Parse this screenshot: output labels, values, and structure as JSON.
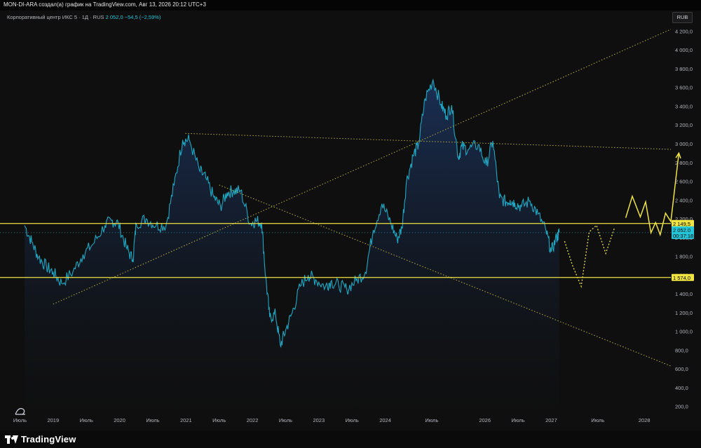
{
  "header": {
    "title": "MON-DI-ARA создал(а) график на TradingView.com, Авг 13, 2026 20:12 UTC+3"
  },
  "legend": {
    "symbol": "Корпоративный центр ИКС 5 · 1Д · RUS",
    "price": "2 052,0",
    "change": "−54,5 (−2,59%)"
  },
  "currency_button": "RUB",
  "branding": {
    "name": "TradingView",
    "icon": "tradingview-logo-icon"
  },
  "colors": {
    "price_line": "#1fa8c4",
    "level_line": "#f0e442",
    "trend_line": "#b8b040",
    "forecast": "#f0e442",
    "background": "#0f0f0f"
  },
  "chart_data": {
    "type": "area",
    "title": "",
    "series": [
      {
        "name": "Корпоративный центр ИКС 5",
        "color": "#1fa8c4"
      }
    ],
    "x": [
      2018.57,
      2018.68,
      2018.78,
      2018.9,
      2019.0,
      2019.13,
      2019.3,
      2019.45,
      2019.6,
      2019.78,
      2019.88,
      2019.98,
      2020.1,
      2020.2,
      2020.25,
      2020.4,
      2020.55,
      2020.7,
      2020.82,
      2020.95,
      2021.05,
      2021.2,
      2021.3,
      2021.42,
      2021.52,
      2021.62,
      2021.72,
      2021.82,
      2021.97,
      2022.05,
      2022.14,
      2022.2,
      2022.26,
      2022.35,
      2022.42,
      2022.5,
      2022.6,
      2022.72,
      2022.84,
      2022.95,
      2023.1,
      2023.18,
      2023.3,
      2023.42,
      2023.56,
      2023.7,
      2023.82,
      2023.95,
      2024.08,
      2024.18,
      2024.25,
      2024.32,
      2024.42,
      2024.5,
      2024.6,
      2024.72,
      2024.84,
      2024.92,
      2025.0,
      2025.1,
      2025.15,
      2025.25,
      2025.4,
      2025.52,
      2025.62,
      2025.72,
      2025.82,
      2025.88,
      2025.95,
      2026.05,
      2026.18,
      2026.3,
      2026.42,
      2026.5,
      2026.58,
      2026.62
    ],
    "y": [
      2130,
      1950,
      1790,
      1690,
      1630,
      1510,
      1640,
      1820,
      1930,
      2130,
      2180,
      2150,
      1900,
      1760,
      2150,
      2200,
      2130,
      2130,
      2560,
      3040,
      3040,
      2720,
      2630,
      2430,
      2330,
      2480,
      2500,
      2500,
      2150,
      2180,
      2160,
      1580,
      1150,
      1180,
      850,
      1010,
      1200,
      1480,
      1600,
      1550,
      1480,
      1530,
      1490,
      1450,
      1540,
      1630,
      2080,
      2360,
      2160,
      1980,
      2100,
      2600,
      2870,
      2990,
      3480,
      3680,
      3420,
      3300,
      3410,
      2850,
      2970,
      2940,
      2990,
      2770,
      3030,
      2420,
      2380,
      2400,
      2370,
      2330,
      2390,
      2250,
      2070,
      1850,
      2000,
      2052
    ],
    "x_ticks": [
      "Июль",
      "2019",
      "Июль",
      "2020",
      "Июль",
      "2021",
      "Июль",
      "2022",
      "Июль",
      "2023",
      "Июль",
      "2024",
      "Июль",
      "2026",
      "Июль",
      "2027",
      "Июль",
      "2028"
    ],
    "x_tick_positions": [
      2018.5,
      2019.0,
      2019.5,
      2020.0,
      2020.5,
      2021.0,
      2021.5,
      2022.0,
      2022.5,
      2023.0,
      2023.5,
      2024.0,
      2024.7,
      2025.5,
      2026.0,
      2026.5,
      2027.2,
      2027.9
    ],
    "y_ticks": [
      "200,0",
      "400,0",
      "600,0",
      "800,0",
      "1 000,0",
      "1 200,0",
      "1 400,0",
      "1 600,0",
      "1 800,0",
      "2 000,0",
      "2 200,0",
      "2 400,0",
      "2 600,0",
      "2 800,0",
      "3 000,0",
      "3 200,0",
      "3 400,0",
      "3 600,0",
      "3 800,0",
      "4 000,0",
      "4 200,0"
    ],
    "y_tick_values": [
      200,
      400,
      600,
      800,
      1000,
      1200,
      1400,
      1600,
      1800,
      2000,
      2200,
      2400,
      2600,
      2800,
      3000,
      3200,
      3400,
      3600,
      3800,
      4000,
      4200
    ],
    "ylim": [
      100,
      4420
    ],
    "xlim": [
      2018.2,
      2028.3
    ],
    "price_labels": [
      {
        "text": "2 149,5",
        "value": 2149.5,
        "style": "level"
      },
      {
        "text": "2 052,0",
        "value": 2052.0,
        "style": "current"
      },
      {
        "text": "00:37:18",
        "value": 1972,
        "style": "countdown"
      },
      {
        "text": "1 574,0",
        "value": 1574.0,
        "style": "level"
      }
    ],
    "horizontal_levels": [
      2149.5,
      1574.0
    ],
    "trend_lines": [
      {
        "name": "rising-trendline",
        "points": [
          [
            2019.0,
            1290
          ],
          [
            2028.3,
            4220
          ]
        ]
      },
      {
        "name": "upper-falling-trendline",
        "points": [
          [
            2020.99,
            3110
          ],
          [
            2028.3,
            2940
          ]
        ]
      },
      {
        "name": "lower-falling-trendline",
        "points": [
          [
            2021.5,
            2560
          ],
          [
            2028.3,
            630
          ]
        ]
      }
    ],
    "forecast_dotted": [
      [
        2026.7,
        1960
      ],
      [
        2026.82,
        1700
      ],
      [
        2026.95,
        1480
      ],
      [
        2027.07,
        2060
      ],
      [
        2027.18,
        2130
      ],
      [
        2027.32,
        1830
      ],
      [
        2027.45,
        2100
      ]
    ],
    "forecast_solid": [
      [
        2027.62,
        2210
      ],
      [
        2027.72,
        2440
      ],
      [
        2027.84,
        2220
      ],
      [
        2027.92,
        2380
      ],
      [
        2028.0,
        2050
      ],
      [
        2028.07,
        2160
      ],
      [
        2028.14,
        2030
      ],
      [
        2028.22,
        2260
      ],
      [
        2028.3,
        2170
      ],
      [
        2028.42,
        2900
      ]
    ]
  }
}
